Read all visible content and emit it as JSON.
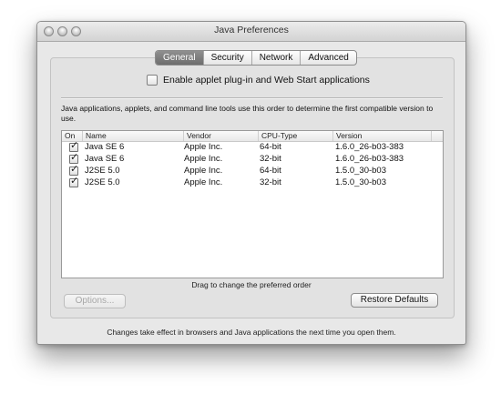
{
  "window": {
    "title": "Java Preferences",
    "controls": [
      "close-button",
      "minimize-button",
      "zoom-button"
    ]
  },
  "tabs": [
    {
      "label": "General",
      "selected": true
    },
    {
      "label": "Security",
      "selected": false
    },
    {
      "label": "Network",
      "selected": false
    },
    {
      "label": "Advanced",
      "selected": false
    }
  ],
  "general": {
    "enable_checkbox": {
      "label": "Enable applet plug-in and Web Start applications",
      "checked": false
    },
    "description": "Java applications, applets, and command line tools use this order to determine the first compatible version to use.",
    "table": {
      "headers": {
        "on": "On",
        "name": "Name",
        "vendor": "Vendor",
        "cpu": "CPU-Type",
        "version": "Version"
      },
      "rows": [
        {
          "checked": true,
          "name": "Java SE 6",
          "vendor": "Apple Inc.",
          "cpu": "64-bit",
          "version": "1.6.0_26-b03-383"
        },
        {
          "checked": true,
          "name": "Java SE 6",
          "vendor": "Apple Inc.",
          "cpu": "32-bit",
          "version": "1.6.0_26-b03-383"
        },
        {
          "checked": true,
          "name": "J2SE 5.0",
          "vendor": "Apple Inc.",
          "cpu": "64-bit",
          "version": "1.5.0_30-b03"
        },
        {
          "checked": true,
          "name": "J2SE 5.0",
          "vendor": "Apple Inc.",
          "cpu": "32-bit",
          "version": "1.5.0_30-b03"
        }
      ]
    },
    "drag_hint": "Drag to change the preferred order",
    "options_button": "Options...",
    "restore_button": "Restore Defaults"
  },
  "footer_note": "Changes take effect in browsers and Java applications the next time you open them.",
  "check_glyph": "✓"
}
